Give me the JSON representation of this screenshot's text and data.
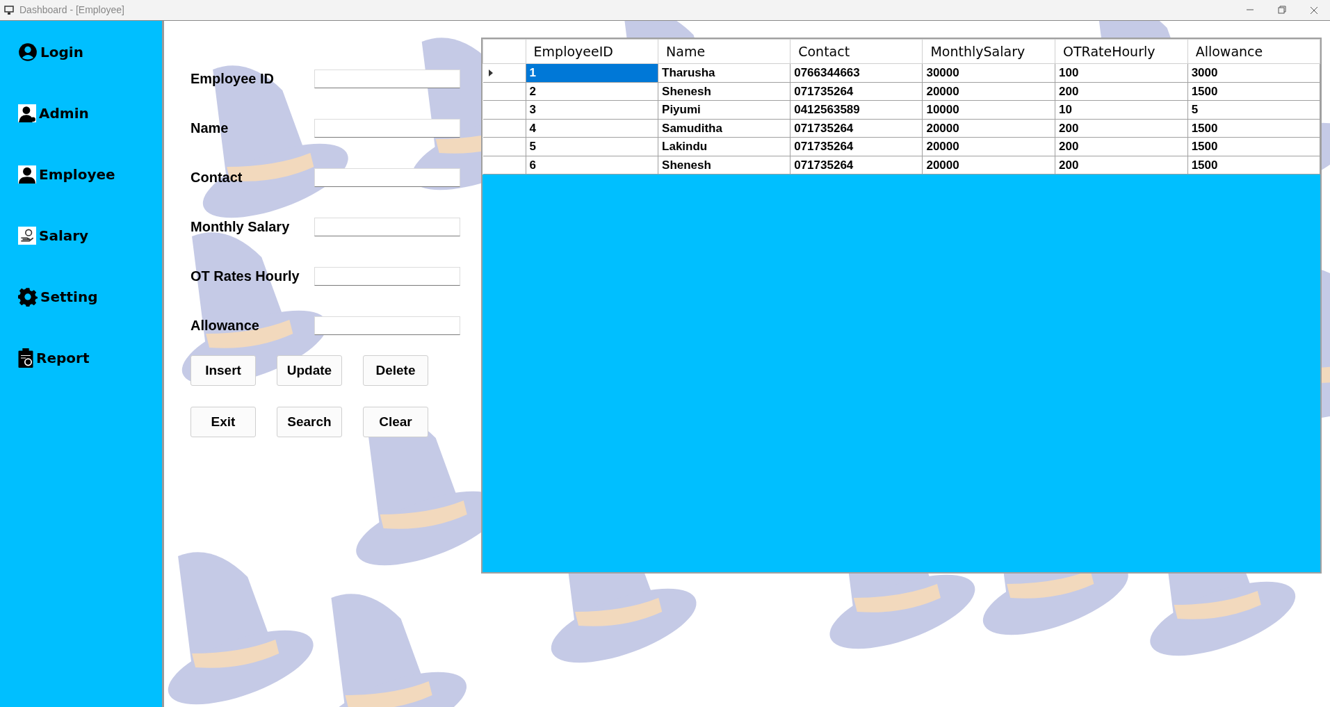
{
  "window": {
    "title": "Dashboard - [Employee]"
  },
  "sidebar": {
    "items": [
      {
        "label": "Login"
      },
      {
        "label": "Admin"
      },
      {
        "label": "Employee"
      },
      {
        "label": "Salary"
      },
      {
        "label": "Setting"
      },
      {
        "label": "Report"
      }
    ]
  },
  "form": {
    "fields": [
      {
        "label": "Employee ID"
      },
      {
        "label": "Name"
      },
      {
        "label": "Contact"
      },
      {
        "label": "Monthly Salary"
      },
      {
        "label": "OT Rates Hourly"
      },
      {
        "label": "Allowance"
      }
    ],
    "buttons": [
      [
        "Insert",
        "Update",
        "Delete"
      ],
      [
        "Exit",
        "Search",
        "Clear"
      ]
    ]
  },
  "table": {
    "columns": [
      "EmployeeID",
      "Name",
      "Contact",
      "MonthlySalary",
      "OTRateHourly",
      "Allowance"
    ],
    "rows": [
      {
        "selected": true,
        "cells": [
          "1",
          "Tharusha",
          "0766344663",
          "30000",
          "100",
          "3000"
        ]
      },
      {
        "selected": false,
        "cells": [
          "2",
          "Shenesh",
          "071735264",
          "20000",
          "200",
          "1500"
        ]
      },
      {
        "selected": false,
        "cells": [
          "3",
          "Piyumi",
          "0412563589",
          "10000",
          "10",
          "5"
        ]
      },
      {
        "selected": false,
        "cells": [
          "4",
          "Samuditha",
          "071735264",
          "20000",
          "200",
          "1500"
        ]
      },
      {
        "selected": false,
        "cells": [
          "5",
          "Lakindu",
          "071735264",
          "20000",
          "200",
          "1500"
        ]
      },
      {
        "selected": false,
        "cells": [
          "6",
          "Shenesh",
          "071735264",
          "20000",
          "200",
          "1500"
        ]
      }
    ]
  }
}
